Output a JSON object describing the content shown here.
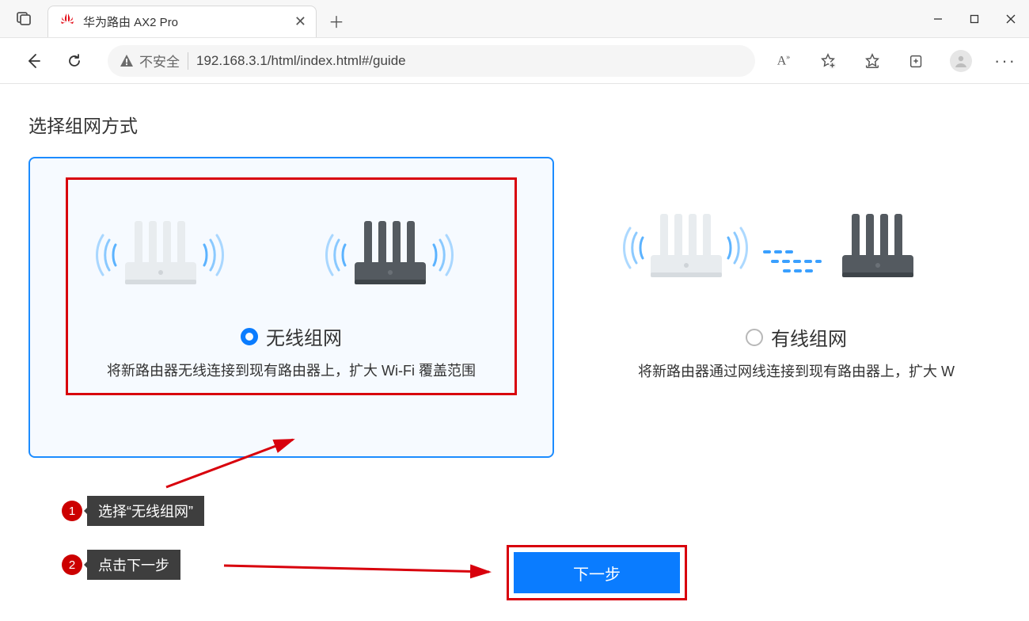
{
  "browser": {
    "tab_title": "华为路由 AX2 Pro",
    "insecure_label": "不安全",
    "url": "192.168.3.1/html/index.html#/guide"
  },
  "page": {
    "title": "选择组网方式"
  },
  "options": {
    "wireless": {
      "label": "无线组网",
      "desc": "将新路由器无线连接到现有路由器上，扩大 Wi-Fi 覆盖范围",
      "selected": true
    },
    "wired": {
      "label": "有线组网",
      "desc": "将新路由器通过网线连接到现有路由器上，扩大 W",
      "selected": false
    }
  },
  "annotations": {
    "step1": {
      "num": "1",
      "text": "选择“无线组网”"
    },
    "step2": {
      "num": "2",
      "text": "点击下一步"
    }
  },
  "actions": {
    "next": "下一步"
  }
}
